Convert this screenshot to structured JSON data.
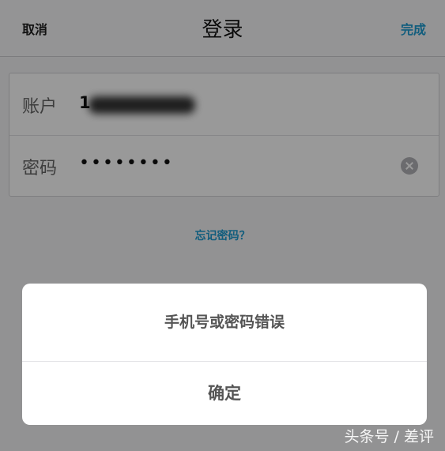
{
  "navbar": {
    "cancel_label": "取消",
    "title": "登录",
    "done_label": "完成"
  },
  "form": {
    "account_label": "账户",
    "account_value_visible": "1",
    "password_label": "密码",
    "password_masked": "••••••••"
  },
  "forgot_password_label": "忘记密码？",
  "alert": {
    "message": "手机号或密码错误",
    "confirm_label": "确定"
  },
  "watermark": "头条号 / 差评",
  "colors": {
    "accent": "#1d9bd1",
    "overlay": "rgba(0,0,0,0.40)"
  },
  "icons": {
    "password_clear": "clear-icon"
  }
}
